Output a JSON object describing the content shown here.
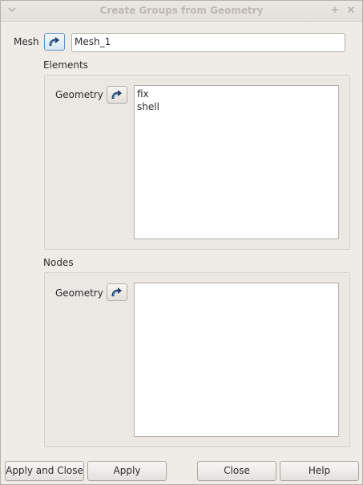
{
  "window": {
    "title": "Create Groups from Geometry",
    "menu_icon": "chevron-down-icon",
    "pin_icon": "pin-icon",
    "close_icon": "close-icon"
  },
  "mesh": {
    "label": "Mesh",
    "value": "Mesh_1",
    "select_icon": "selection-arrow-icon"
  },
  "elements": {
    "group_title": "Elements",
    "geometry_label": "Geometry",
    "items": [
      "fix",
      "shell"
    ]
  },
  "nodes": {
    "group_title": "Nodes",
    "geometry_label": "Geometry",
    "items": []
  },
  "buttons": {
    "apply_and_close": "Apply and Close",
    "apply": "Apply",
    "close": "Close",
    "help": "Help"
  },
  "colors": {
    "window_bg": "#efebe7",
    "active_select_border": "#5f93c2"
  }
}
